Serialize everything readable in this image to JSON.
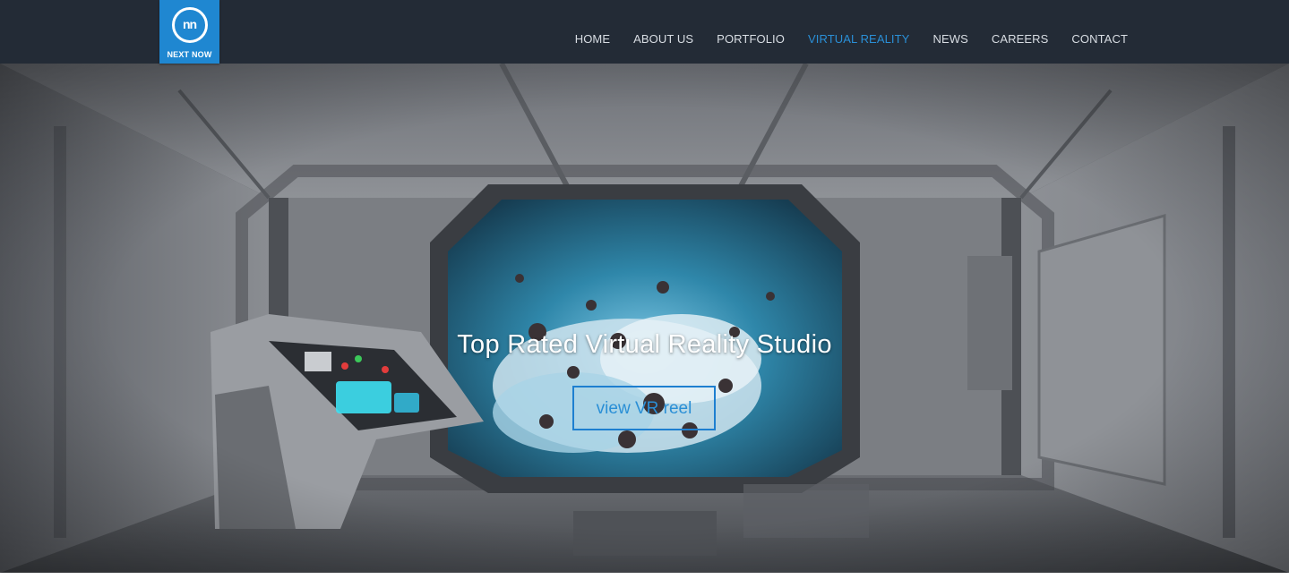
{
  "brand": {
    "logo_monogram": "nn",
    "logo_text": "NEXT NOW",
    "accent_color": "#1f87d1"
  },
  "nav": {
    "items": [
      {
        "label": "HOME",
        "active": false
      },
      {
        "label": "ABOUT US",
        "active": false
      },
      {
        "label": "PORTFOLIO",
        "active": false
      },
      {
        "label": "VIRTUAL REALITY",
        "active": true
      },
      {
        "label": "NEWS",
        "active": false
      },
      {
        "label": "CAREERS",
        "active": false
      },
      {
        "label": "CONTACT",
        "active": false
      }
    ]
  },
  "hero": {
    "title": "Top Rated Virtual Reality Studio",
    "button_label": "view VR reel"
  }
}
